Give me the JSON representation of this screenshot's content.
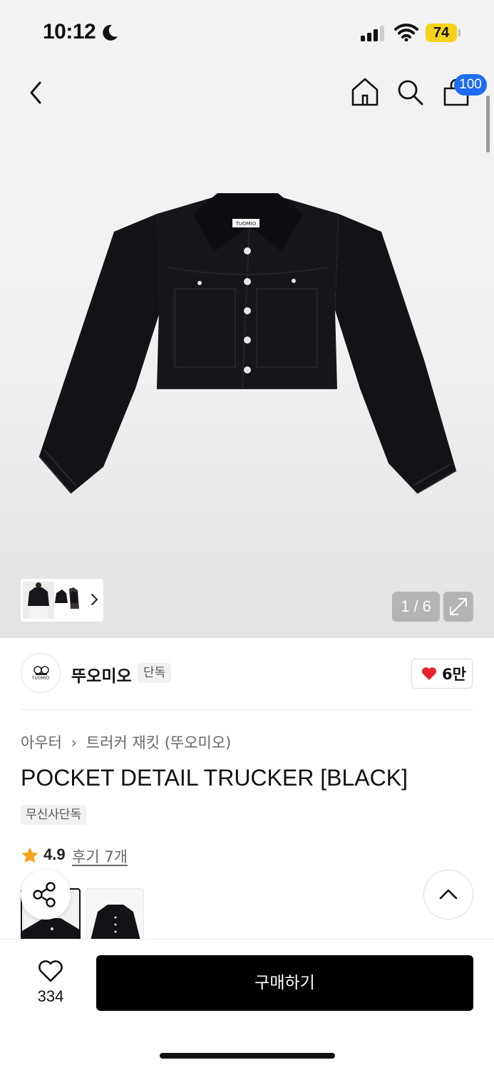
{
  "status_bar": {
    "time": "10:12",
    "battery": "74"
  },
  "nav": {
    "cart_badge": "100"
  },
  "gallery": {
    "counter": "1 / 6"
  },
  "brand": {
    "name": "뚜오미오",
    "badge": "단독",
    "likes": "6만",
    "logo_text": "TUOMIO"
  },
  "product": {
    "breadcrumb_category": "아우터",
    "breadcrumb_sub": "트러커 재킷 (뚜오미오)",
    "title": "POCKET DETAIL TRUCKER [BLACK]",
    "exclusive_badge": "무신사단독",
    "rating": "4.9",
    "reviews": "후기 7개"
  },
  "bottom_bar": {
    "wish_count": "334",
    "buy_label": "구매하기"
  },
  "colors": {
    "accent_badge": "#1e6cf2",
    "battery": "#f5d21b",
    "heart": "#e8232b",
    "star": "#f7a21b",
    "buy_button": "#000000"
  }
}
